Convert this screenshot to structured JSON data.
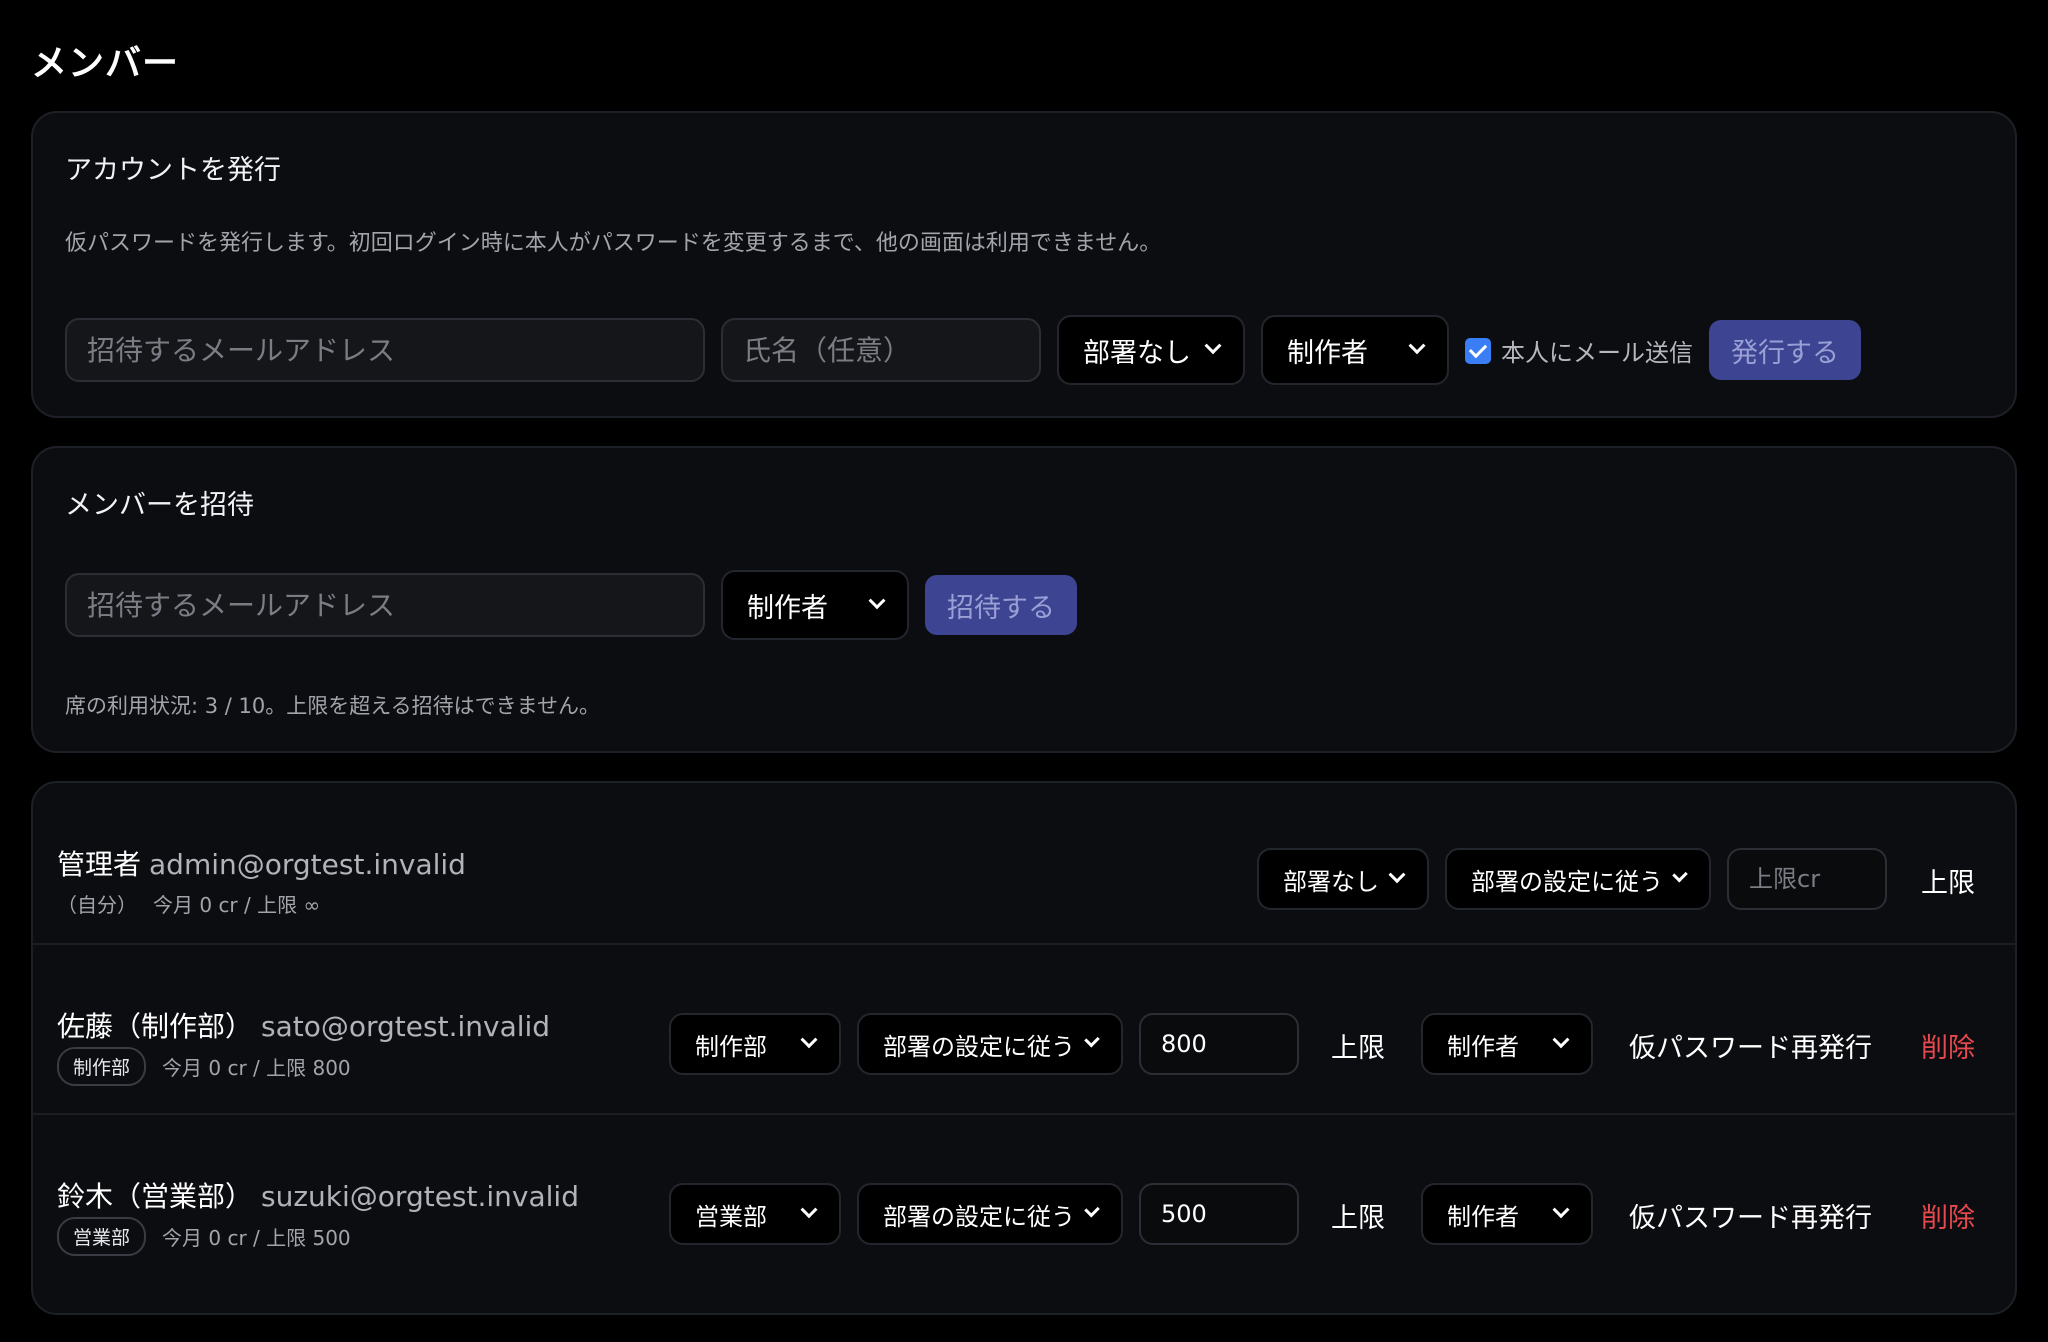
{
  "page": {
    "title": "メンバー"
  },
  "issue_account": {
    "title": "アカウントを発行",
    "description": "仮パスワードを発行します。初回ログイン時に本人がパスワードを変更するまで、他の画面は利用できません。",
    "email_placeholder": "招待するメールアドレス",
    "name_placeholder": "氏名（任意）",
    "department_select": "部署なし",
    "role_select": "制作者",
    "send_mail_label": "本人にメール送信",
    "send_mail_checked": true,
    "submit_label": "発行する"
  },
  "invite_member": {
    "title": "メンバーを招待",
    "email_placeholder": "招待するメールアドレス",
    "role_select": "制作者",
    "submit_label": "招待する",
    "seat_status": "席の利用状況: 3 / 10。上限を超える招待はできません。"
  },
  "members": [
    {
      "name": "管理者",
      "email": "admin@orgtest.invalid",
      "self_tag": "（自分）",
      "usage": "今月 0 cr / 上限 ∞",
      "department": "部署なし",
      "limit_mode": "部署の設定に従う",
      "limit_placeholder": "上限cr",
      "limit_value": "",
      "limit_label": "上限"
    },
    {
      "name": "佐藤（制作部）",
      "email": "sato@orgtest.invalid",
      "badge": "制作部",
      "usage": "今月 0 cr / 上限 800",
      "department": "制作部",
      "limit_mode": "部署の設定に従う",
      "limit_value": "800",
      "limit_label": "上限",
      "role": "制作者",
      "reissue_label": "仮パスワード再発行",
      "delete_label": "削除"
    },
    {
      "name": "鈴木（営業部）",
      "email": "suzuki@orgtest.invalid",
      "badge": "営業部",
      "usage": "今月 0 cr / 上限 500",
      "department": "営業部",
      "limit_mode": "部署の設定に従う",
      "limit_value": "500",
      "limit_label": "上限",
      "role": "制作者",
      "reissue_label": "仮パスワード再発行",
      "delete_label": "削除"
    }
  ],
  "colors": {
    "background": "#000000",
    "card": "#0c0d10",
    "primary_button": "#3d4491",
    "danger": "#e5484d",
    "checkbox": "#3a7ef6"
  }
}
